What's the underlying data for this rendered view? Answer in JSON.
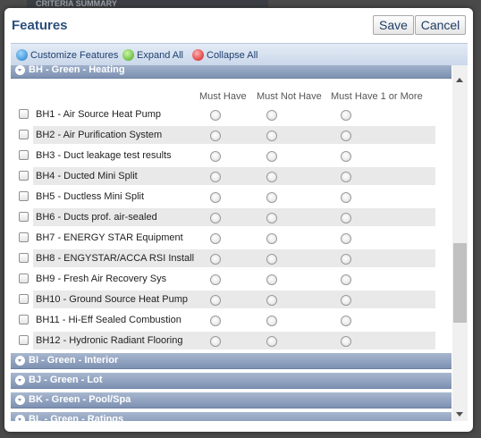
{
  "background": {
    "tab_label": "CRITERIA SUMMARY"
  },
  "dialog": {
    "title": "Features",
    "save_label": "Save",
    "cancel_label": "Cancel"
  },
  "toolbar": {
    "customize_label": "Customize Features",
    "expand_label": "Expand All",
    "collapse_label": "Collapse All"
  },
  "columns": {
    "must_have": "Must Have",
    "must_not_have": "Must Not Have",
    "must_have_one": "Must Have 1 or More"
  },
  "groups": [
    {
      "label": "BH - Green - Heating"
    },
    {
      "label": "BI - Green - Interior"
    },
    {
      "label": "BJ - Green - Lot"
    },
    {
      "label": "BK - Green - Pool/Spa"
    },
    {
      "label": "BL - Green - Ratings"
    }
  ],
  "rows": [
    {
      "label": "BH1 - Air Source Heat Pump"
    },
    {
      "label": "BH2 - Air Purification System"
    },
    {
      "label": "BH3 - Duct leakage test results"
    },
    {
      "label": "BH4 - Ducted Mini Split"
    },
    {
      "label": "BH5 - Ductless Mini Split"
    },
    {
      "label": "BH6 - Ducts prof. air-sealed"
    },
    {
      "label": "BH7 - ENERGY STAR Equipment"
    },
    {
      "label": "BH8 - ENGYSTAR/ACCA RSI Install"
    },
    {
      "label": "BH9 - Fresh Air Recovery Sys"
    },
    {
      "label": "BH10 - Ground Source Heat Pump"
    },
    {
      "label": "BH11 - Hi-Eff Sealed Combustion"
    },
    {
      "label": "BH12 - Hydronic Radiant Flooring"
    }
  ]
}
